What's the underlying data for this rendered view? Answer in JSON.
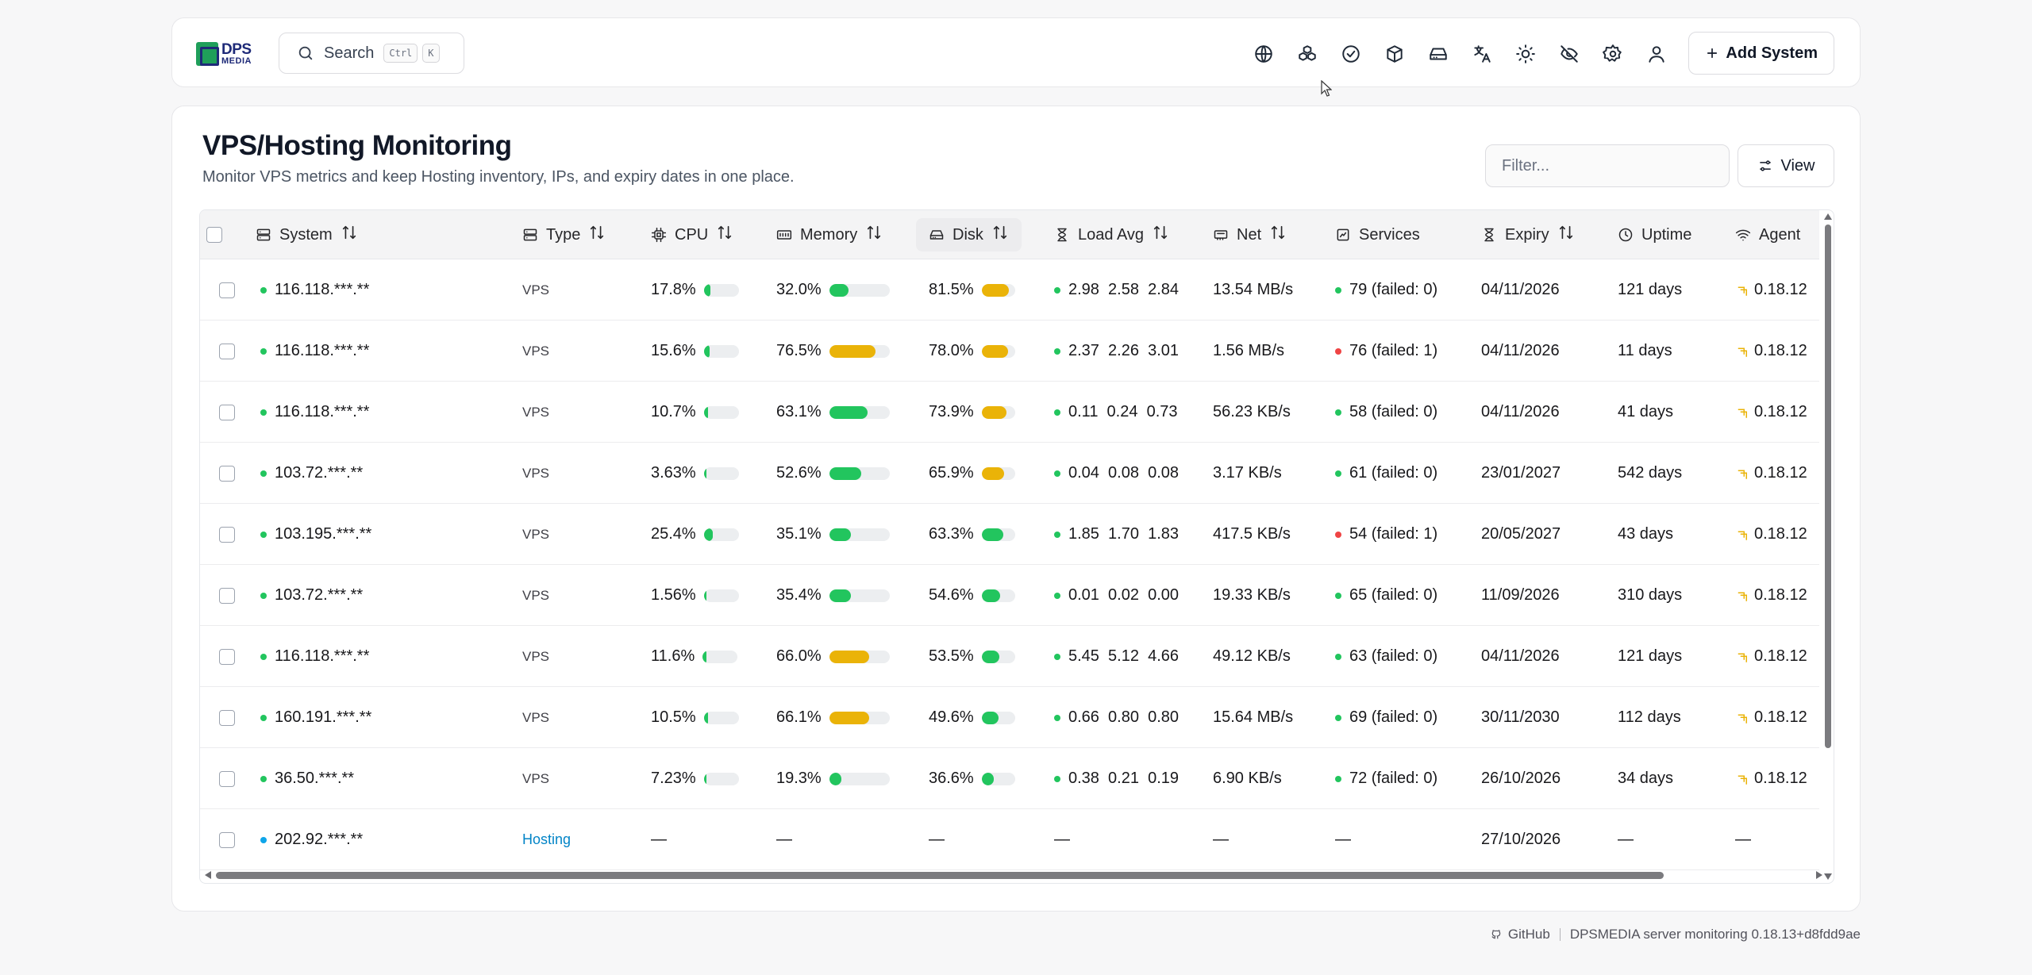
{
  "brand": {
    "logo_text_top": "DPS",
    "logo_text_bottom": "MEDIA"
  },
  "search": {
    "label": "Search",
    "shortcut_mod": "Ctrl",
    "shortcut_key": "K"
  },
  "top_icons": [
    "globe-icon",
    "boxes-icon",
    "check-circle-icon",
    "package-icon",
    "hard-drive-icon",
    "translate-icon",
    "sun-icon",
    "eye-off-icon",
    "settings-icon",
    "user-icon"
  ],
  "add_system": {
    "label": "Add System"
  },
  "page": {
    "title": "VPS/Hosting Monitoring",
    "subtitle": "Monitor VPS metrics and keep Hosting inventory, IPs, and expiry dates in one place."
  },
  "filter": {
    "placeholder": "Filter..."
  },
  "view": {
    "label": "View"
  },
  "columns": {
    "system": "System",
    "type": "Type",
    "cpu": "CPU",
    "memory": "Memory",
    "disk": "Disk",
    "load": "Load Avg",
    "net": "Net",
    "services": "Services",
    "expiry": "Expiry",
    "uptime": "Uptime",
    "agent": "Agent"
  },
  "colors": {
    "bar_green": "#22c55e",
    "bar_yellow": "#eab308",
    "bar_track": "#eceef0",
    "status_green": "#22c55e",
    "status_red": "#ef4444",
    "status_blue": "#0ea5e9"
  },
  "rows": [
    {
      "system": "116.118.***.**",
      "status": "green",
      "type": "VPS",
      "cpu": "17.8%",
      "cpu_v": 17.8,
      "mem": "32.0%",
      "mem_v": 32.0,
      "disk": "81.5%",
      "disk_v": 81.5,
      "load": "2.98  2.58  2.84",
      "net": "13.54 MB/s",
      "svc": "79 (failed: 0)",
      "svc_status": "green",
      "expiry": "04/11/2026",
      "uptime": "121 days",
      "agent": "0.18.12"
    },
    {
      "system": "116.118.***.**",
      "status": "green",
      "type": "VPS",
      "cpu": "15.6%",
      "cpu_v": 15.6,
      "mem": "76.5%",
      "mem_v": 76.5,
      "disk": "78.0%",
      "disk_v": 78.0,
      "load": "2.37  2.26  3.01",
      "net": "1.56 MB/s",
      "svc": "76 (failed: 1)",
      "svc_status": "red",
      "expiry": "04/11/2026",
      "uptime": "11 days",
      "agent": "0.18.12"
    },
    {
      "system": "116.118.***.**",
      "status": "green",
      "type": "VPS",
      "cpu": "10.7%",
      "cpu_v": 10.7,
      "mem": "63.1%",
      "mem_v": 63.1,
      "disk": "73.9%",
      "disk_v": 73.9,
      "load": "0.11  0.24  0.73",
      "net": "56.23 KB/s",
      "svc": "58 (failed: 0)",
      "svc_status": "green",
      "expiry": "04/11/2026",
      "uptime": "41 days",
      "agent": "0.18.12"
    },
    {
      "system": "103.72.***.**",
      "status": "green",
      "type": "VPS",
      "cpu": "3.63%",
      "cpu_v": 3.63,
      "mem": "52.6%",
      "mem_v": 52.6,
      "disk": "65.9%",
      "disk_v": 65.9,
      "load": "0.04  0.08  0.08",
      "net": "3.17 KB/s",
      "svc": "61 (failed: 0)",
      "svc_status": "green",
      "expiry": "23/01/2027",
      "uptime": "542 days",
      "agent": "0.18.12"
    },
    {
      "system": "103.195.***.**",
      "status": "green",
      "type": "VPS",
      "cpu": "25.4%",
      "cpu_v": 25.4,
      "mem": "35.1%",
      "mem_v": 35.1,
      "disk": "63.3%",
      "disk_v": 63.3,
      "load": "1.85  1.70  1.83",
      "net": "417.5 KB/s",
      "svc": "54 (failed: 1)",
      "svc_status": "red",
      "expiry": "20/05/2027",
      "uptime": "43 days",
      "agent": "0.18.12"
    },
    {
      "system": "103.72.***.**",
      "status": "green",
      "type": "VPS",
      "cpu": "1.56%",
      "cpu_v": 1.56,
      "mem": "35.4%",
      "mem_v": 35.4,
      "disk": "54.6%",
      "disk_v": 54.6,
      "load": "0.01  0.02  0.00",
      "net": "19.33 KB/s",
      "svc": "65 (failed: 0)",
      "svc_status": "green",
      "expiry": "11/09/2026",
      "uptime": "310 days",
      "agent": "0.18.12"
    },
    {
      "system": "116.118.***.**",
      "status": "green",
      "type": "VPS",
      "cpu": "11.6%",
      "cpu_v": 11.6,
      "mem": "66.0%",
      "mem_v": 66.0,
      "disk": "53.5%",
      "disk_v": 53.5,
      "load": "5.45  5.12  4.66",
      "net": "49.12 KB/s",
      "svc": "63 (failed: 0)",
      "svc_status": "green",
      "expiry": "04/11/2026",
      "uptime": "121 days",
      "agent": "0.18.12"
    },
    {
      "system": "160.191.***.**",
      "status": "green",
      "type": "VPS",
      "cpu": "10.5%",
      "cpu_v": 10.5,
      "mem": "66.1%",
      "mem_v": 66.1,
      "disk": "49.6%",
      "disk_v": 49.6,
      "load": "0.66  0.80  0.80",
      "net": "15.64 MB/s",
      "svc": "69 (failed: 0)",
      "svc_status": "green",
      "expiry": "30/11/2030",
      "uptime": "112 days",
      "agent": "0.18.12"
    },
    {
      "system": "36.50.***.**",
      "status": "green",
      "type": "VPS",
      "cpu": "7.23%",
      "cpu_v": 7.23,
      "mem": "19.3%",
      "mem_v": 19.3,
      "disk": "36.6%",
      "disk_v": 36.6,
      "load": "0.38  0.21  0.19",
      "net": "6.90 KB/s",
      "svc": "72 (failed: 0)",
      "svc_status": "green",
      "expiry": "26/10/2026",
      "uptime": "34 days",
      "agent": "0.18.12"
    },
    {
      "system": "202.92.***.**",
      "status": "blue",
      "type": "Hosting",
      "cpu": "—",
      "mem": "—",
      "disk": "—",
      "load": "—",
      "net": "—",
      "svc": "—",
      "expiry": "27/10/2026",
      "uptime": "—",
      "agent": "—"
    }
  ],
  "footer": {
    "github": "GitHub",
    "version": "DPSMEDIA server monitoring 0.18.13+d8fdd9ae"
  }
}
